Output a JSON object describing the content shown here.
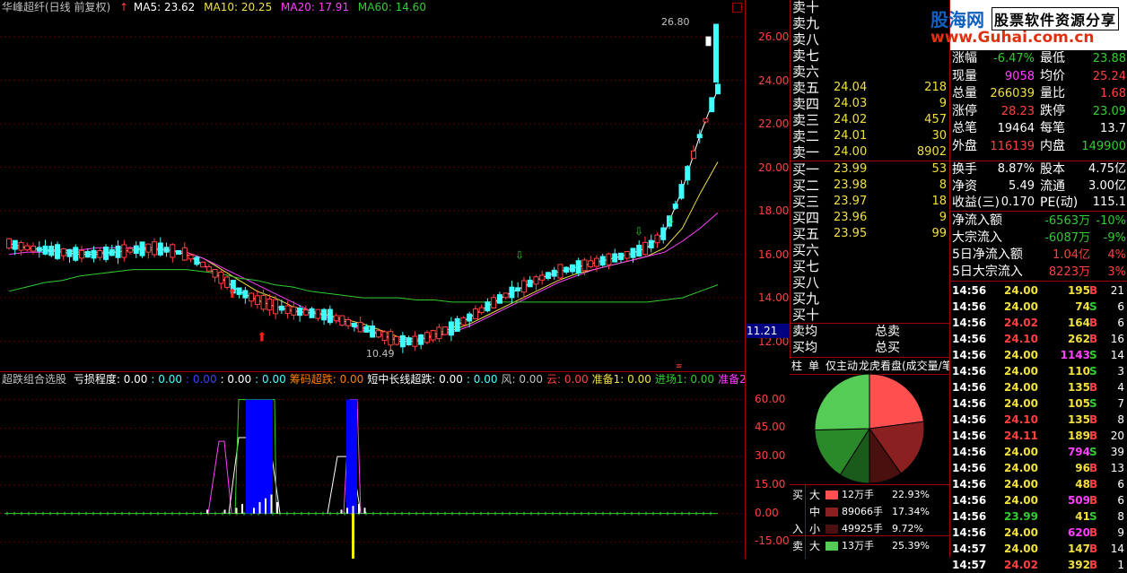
{
  "chart_header": {
    "title": "华峰超纤(日线 前复权)",
    "ma5": "MA5: 23.62",
    "ma10": "MA10: 20.25",
    "ma20": "MA20: 17.91",
    "ma60": "MA60: 14.60"
  },
  "price_axis": [
    "26.00",
    "24.00",
    "22.00",
    "20.00",
    "18.00",
    "16.00",
    "14.00",
    "12.00"
  ],
  "current_price_tag": "11.21",
  "annotations": {
    "high": "26.80",
    "low": "10.49"
  },
  "indicator_header": {
    "name": "超跌组合选股",
    "items": [
      {
        "text": "亏损程度: 0.00",
        "color": "#ffffff"
      },
      {
        "text": ": 0.00",
        "color": "#40ffff"
      },
      {
        "text": ": 0.00",
        "color": "#4040ff"
      },
      {
        "text": ": 0.00",
        "color": "#ffffff"
      },
      {
        "text": ": 0.00",
        "color": "#40ffff"
      },
      {
        "text": "筹码超跌: 0.00",
        "color": "#ff8000"
      },
      {
        "text": "短中长线超跌: 0.00",
        "color": "#ffffff"
      },
      {
        "text": ": 0.00",
        "color": "#40ffff"
      },
      {
        "text": "风: 0.00",
        "color": "#c0c0c0"
      },
      {
        "text": "云: 0.00",
        "color": "#ff4040"
      },
      {
        "text": "准备1: 0.00",
        "color": "#f0e040"
      },
      {
        "text": "进场1: 0.00",
        "color": "#33cc33"
      },
      {
        "text": "准备2",
        "color": "#ff40ff"
      }
    ]
  },
  "indicator_axis": [
    "60.00",
    "45.00",
    "30.00",
    "15.00",
    "0.00",
    "-15.00"
  ],
  "chart_data": [
    {
      "type": "line",
      "title": "华峰超纤(日线 前复权)",
      "ylim": [
        11.2,
        27.2
      ],
      "series": [
        {
          "name": "MA5",
          "color": "#ffffff",
          "values": [
            16.5,
            16.3,
            16.2,
            16.1,
            16.0,
            16.0,
            16.1,
            16.2,
            16.3,
            16.2,
            16.0,
            15.5,
            14.9,
            14.3,
            13.9,
            13.6,
            13.4,
            13.3,
            13.2,
            12.9,
            12.6,
            12.3,
            12.0,
            12.0,
            12.3,
            12.6,
            13.1,
            13.6,
            14.1,
            14.5,
            14.9,
            15.2,
            15.4,
            15.6,
            15.8,
            16.0,
            16.3,
            17.0,
            19.0,
            21.5,
            23.6
          ]
        },
        {
          "name": "MA10",
          "color": "#f0e040",
          "values": [
            16.3,
            16.3,
            16.2,
            16.2,
            16.1,
            16.1,
            16.1,
            16.2,
            16.2,
            16.2,
            16.1,
            15.8,
            15.3,
            14.8,
            14.3,
            14.0,
            13.6,
            13.4,
            13.2,
            13.0,
            12.8,
            12.5,
            12.2,
            12.1,
            12.2,
            12.5,
            12.8,
            13.2,
            13.6,
            14.0,
            14.4,
            14.8,
            15.1,
            15.3,
            15.5,
            15.7,
            15.9,
            16.3,
            17.2,
            18.8,
            20.25
          ]
        },
        {
          "name": "MA20",
          "color": "#ff40ff",
          "values": [
            16.0,
            16.1,
            16.1,
            16.2,
            16.2,
            16.3,
            16.3,
            16.3,
            16.3,
            16.2,
            16.1,
            15.8,
            15.4,
            15.0,
            14.6,
            14.2,
            13.8,
            13.4,
            13.1,
            12.8,
            12.5,
            12.3,
            12.1,
            12.1,
            12.2,
            12.4,
            12.7,
            13.1,
            13.5,
            13.9,
            14.3,
            14.7,
            15.0,
            15.3,
            15.5,
            15.7,
            15.9,
            16.1,
            16.6,
            17.2,
            17.91
          ]
        },
        {
          "name": "MA60",
          "color": "#33cc33",
          "values": [
            14.3,
            14.5,
            14.7,
            14.8,
            15.0,
            15.1,
            15.2,
            15.3,
            15.3,
            15.3,
            15.3,
            15.2,
            15.1,
            14.9,
            14.8,
            14.6,
            14.5,
            14.3,
            14.2,
            14.1,
            14.0,
            14.0,
            14.0,
            13.9,
            13.9,
            13.8,
            13.8,
            13.8,
            13.8,
            13.8,
            13.8,
            13.8,
            13.8,
            13.8,
            13.8,
            13.8,
            13.8,
            13.9,
            14.0,
            14.3,
            14.6
          ]
        }
      ]
    },
    {
      "type": "bar",
      "title": "超跌组合选股",
      "ylim": [
        -20,
        65
      ],
      "x": [
        12,
        15,
        17,
        18,
        20,
        21,
        22,
        23,
        24,
        35,
        36,
        37,
        38,
        39
      ],
      "values": [
        2,
        2,
        3,
        5,
        3,
        6,
        8,
        10,
        6,
        2,
        3,
        4,
        5,
        3
      ]
    }
  ],
  "order_book": {
    "sell": [
      {
        "label": "卖十",
        "price": "",
        "vol": ""
      },
      {
        "label": "卖九",
        "price": "",
        "vol": ""
      },
      {
        "label": "卖八",
        "price": "",
        "vol": ""
      },
      {
        "label": "卖七",
        "price": "",
        "vol": ""
      },
      {
        "label": "卖六",
        "price": "",
        "vol": ""
      },
      {
        "label": "卖五",
        "price": "24.04",
        "vol": "218"
      },
      {
        "label": "卖四",
        "price": "24.03",
        "vol": "9"
      },
      {
        "label": "卖三",
        "price": "24.02",
        "vol": "457"
      },
      {
        "label": "卖二",
        "price": "24.01",
        "vol": "30"
      },
      {
        "label": "卖一",
        "price": "24.00",
        "vol": "8902"
      }
    ],
    "buy": [
      {
        "label": "买一",
        "price": "23.99",
        "vol": "53"
      },
      {
        "label": "买二",
        "price": "23.98",
        "vol": "8"
      },
      {
        "label": "买三",
        "price": "23.97",
        "vol": "18"
      },
      {
        "label": "买四",
        "price": "23.96",
        "vol": "9"
      },
      {
        "label": "买五",
        "price": "23.95",
        "vol": "99"
      },
      {
        "label": "买六",
        "price": "",
        "vol": ""
      },
      {
        "label": "买七",
        "price": "",
        "vol": ""
      },
      {
        "label": "买八",
        "price": "",
        "vol": ""
      },
      {
        "label": "买九",
        "price": "",
        "vol": ""
      },
      {
        "label": "买十",
        "price": "",
        "vol": ""
      }
    ],
    "avg": [
      {
        "label": "卖均",
        "total": "总卖"
      },
      {
        "label": "买均",
        "total": "总买"
      }
    ]
  },
  "tabs": [
    "柱",
    "单",
    "仅主动",
    "龙虎看盘(成交量/笔"
  ],
  "pie": {
    "slices": [
      {
        "pct": 22.93,
        "color": "#ff5050"
      },
      {
        "pct": 17.34,
        "color": "#8b2020"
      },
      {
        "pct": 9.72,
        "color": "#4a1010"
      },
      {
        "pct": 9.0,
        "color": "#1a5a1a"
      },
      {
        "pct": 15.62,
        "color": "#2a8a2a"
      },
      {
        "pct": 25.39,
        "color": "#55cc55"
      }
    ]
  },
  "flow_table": [
    {
      "side": "买",
      "size": "大",
      "amount": "12万手",
      "pct": "22.93%",
      "color": "#ff5050"
    },
    {
      "side": "",
      "size": "中",
      "amount": "89066手",
      "pct": "17.34%",
      "color": "#8b2020"
    },
    {
      "side": "入",
      "size": "小",
      "amount": "49925手",
      "pct": "9.72%",
      "color": "#4a1010"
    },
    {
      "side": "卖",
      "size": "大",
      "amount": "13万手",
      "pct": "25.39%",
      "color": "#55cc55"
    }
  ],
  "watermark": {
    "brand": "股海网",
    "slogan": "股票软件资源分享",
    "url": "www.Guhai.com.cn"
  },
  "quote_stats": [
    {
      "l1": "涨幅",
      "v1": "-6.47%",
      "c1": "#33cc33",
      "l2": "最低",
      "v2": "23.88",
      "c2": "#33cc33"
    },
    {
      "l1": "现量",
      "v1": "9058",
      "c1": "#ff40ff",
      "l2": "均价",
      "v2": "25.24",
      "c2": "#ff4040"
    },
    {
      "l1": "总量",
      "v1": "266039",
      "c1": "#f0e040",
      "l2": "量比",
      "v2": "1.68",
      "c2": "#ff4040"
    },
    {
      "l1": "涨停",
      "v1": "28.23",
      "c1": "#ff4040",
      "l2": "跌停",
      "v2": "23.09",
      "c2": "#33cc33"
    },
    {
      "l1": "总笔",
      "v1": "19464",
      "c1": "#ffffff",
      "l2": "每笔",
      "v2": "13.7",
      "c2": "#ffffff"
    },
    {
      "l1": "外盘",
      "v1": "116139",
      "c1": "#ff4040",
      "l2": "内盘",
      "v2": "149900",
      "c2": "#33cc33"
    }
  ],
  "fundamentals": [
    {
      "l1": "换手",
      "v1": "8.87%",
      "l2": "股本",
      "v2": "4.75亿"
    },
    {
      "l1": "净资",
      "v1": "5.49",
      "l2": "流通",
      "v2": "3.00亿"
    },
    {
      "l1": "收益(三)",
      "v1": "0.170",
      "l2": "PE(动)",
      "v2": "115.1"
    }
  ],
  "money_flow": [
    {
      "label": "净流入额",
      "value": "-6563万",
      "pct": "-10%",
      "color": "#33cc33"
    },
    {
      "label": "大宗流入",
      "value": "-6087万",
      "pct": "-9%",
      "color": "#33cc33"
    },
    {
      "label": "5日净流入额",
      "value": "1.04亿",
      "pct": "4%",
      "color": "#ff4040"
    },
    {
      "label": "5日大宗流入",
      "value": "8223万",
      "pct": "3%",
      "color": "#ff4040"
    }
  ],
  "ticks": [
    {
      "time": "14:56",
      "price": "24.00",
      "vol": "195",
      "bs": "B",
      "n": "21"
    },
    {
      "time": "14:56",
      "price": "24.00",
      "vol": "74",
      "bs": "S",
      "n": "6"
    },
    {
      "time": "14:56",
      "price": "24.02",
      "vol": "164",
      "bs": "B",
      "n": "6"
    },
    {
      "time": "14:56",
      "price": "24.10",
      "vol": "262",
      "bs": "B",
      "n": "16"
    },
    {
      "time": "14:56",
      "price": "24.00",
      "vol": "1143",
      "bs": "S",
      "n": "14"
    },
    {
      "time": "14:56",
      "price": "24.00",
      "vol": "110",
      "bs": "S",
      "n": "3"
    },
    {
      "time": "14:56",
      "price": "24.00",
      "vol": "135",
      "bs": "B",
      "n": "4"
    },
    {
      "time": "14:56",
      "price": "24.00",
      "vol": "105",
      "bs": "S",
      "n": "7"
    },
    {
      "time": "14:56",
      "price": "24.10",
      "vol": "135",
      "bs": "B",
      "n": "8"
    },
    {
      "time": "14:56",
      "price": "24.11",
      "vol": "189",
      "bs": "B",
      "n": "20"
    },
    {
      "time": "14:56",
      "price": "24.00",
      "vol": "794",
      "bs": "S",
      "n": "39"
    },
    {
      "time": "14:56",
      "price": "24.00",
      "vol": "96",
      "bs": "B",
      "n": "13"
    },
    {
      "time": "14:56",
      "price": "24.00",
      "vol": "48",
      "bs": "B",
      "n": "6"
    },
    {
      "time": "14:56",
      "price": "24.00",
      "vol": "509",
      "bs": "B",
      "n": "6"
    },
    {
      "time": "14:56",
      "price": "23.99",
      "vol": "41",
      "bs": "S",
      "n": "8"
    },
    {
      "time": "14:56",
      "price": "24.00",
      "vol": "620",
      "bs": "B",
      "n": "9"
    },
    {
      "time": "14:57",
      "price": "24.00",
      "vol": "147",
      "bs": "B",
      "n": "14"
    },
    {
      "time": "14:57",
      "price": "24.02",
      "vol": "392",
      "bs": "B",
      "n": "1"
    }
  ]
}
